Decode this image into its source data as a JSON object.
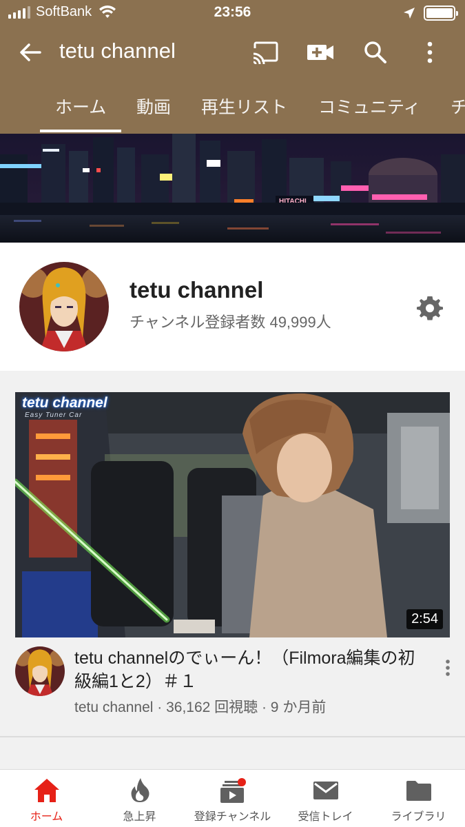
{
  "status_bar": {
    "carrier": "SoftBank",
    "time": "23:56"
  },
  "app_bar": {
    "title": "tetu channel"
  },
  "tabs": [
    {
      "label": "ホーム",
      "active": true
    },
    {
      "label": "動画"
    },
    {
      "label": "再生リスト"
    },
    {
      "label": "コミュニティ"
    },
    {
      "label": "チ"
    }
  ],
  "banner": {
    "sign": "HITACHI"
  },
  "channel": {
    "name": "tetu channel",
    "subscribers": "チャンネル登録者数 49,999人"
  },
  "video": {
    "thumbnail_overlay_title": "tetu channel",
    "thumbnail_overlay_subtitle": "Easy Tuner Car",
    "duration": "2:54",
    "title": "tetu channelのでぃーん！（Filmora編集の初級編1と2）＃１",
    "meta": "tetu channel · 36,162 回視聴 · 9 か月前"
  },
  "bottom_nav": [
    {
      "label": "ホーム",
      "icon": "home-icon",
      "active": true
    },
    {
      "label": "急上昇",
      "icon": "trending-icon"
    },
    {
      "label": "登録チャンネル",
      "icon": "subscriptions-icon",
      "badge": true
    },
    {
      "label": "受信トレイ",
      "icon": "inbox-icon"
    },
    {
      "label": "ライブラリ",
      "icon": "library-icon"
    }
  ],
  "colors": {
    "brand": "#8b7150",
    "accent": "#e62117",
    "background": "#f1f1f1"
  }
}
